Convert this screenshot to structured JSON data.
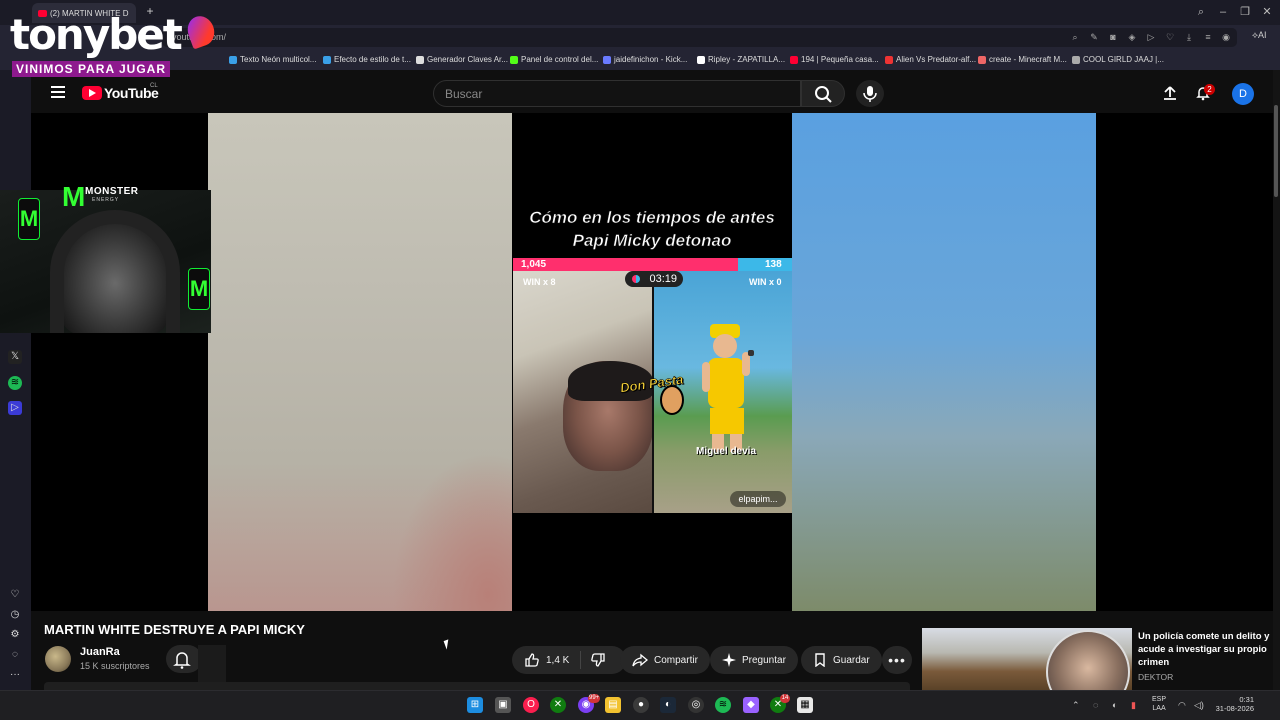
{
  "browser": {
    "tab_title": "(2) MARTIN WHITE D",
    "url": "youtube.com/",
    "ai_label": "AI",
    "bookmarks": [
      {
        "label": "Texto Neón multicol...",
        "color": "#3aa0e8"
      },
      {
        "label": "Efecto de estilo de t...",
        "color": "#3aa0e8"
      },
      {
        "label": "Generador Claves Ar...",
        "color": "#dddddd"
      },
      {
        "label": "Panel de control del...",
        "color": "#53fc18"
      },
      {
        "label": "jaidefinichon - Kick...",
        "color": "#6a7bff"
      },
      {
        "label": "Ripley - ZAPATILLA...",
        "color": "#ffffff"
      },
      {
        "label": "194 | Pequeña casa...",
        "color": "#ff0033"
      },
      {
        "label": "Alien Vs Predator-alf...",
        "color": "#e33"
      },
      {
        "label": "create - Minecraft M...",
        "color": "#e66"
      },
      {
        "label": "COOL GIRLD JAAJ |...",
        "color": "#aaaaaa"
      }
    ]
  },
  "overlay": {
    "brand": "tonybet",
    "brand_tagline": "VINIMOS PARA JUGAR",
    "sponsor": "MONSTER",
    "sponsor_sub": "ENERGY"
  },
  "youtube": {
    "logo_text": "YouTube",
    "country_code": "CL",
    "search_placeholder": "Buscar",
    "notifications": "2",
    "avatar_letter": "D"
  },
  "video": {
    "caption_line1": "Cómo en los tiempos de antes",
    "caption_line2": "Papi Micky detonao",
    "score_left": "1,045",
    "score_right": "138",
    "timer": "03:19",
    "win_left": "WIN x 8",
    "win_right": "WIN x 0",
    "sticker_text": "Don Pasta",
    "right_user": "Miguel devia",
    "tiktok_user": "elpapim..."
  },
  "details": {
    "title": "MARTIN WHITE DESTRUYE A PAPI MICKY",
    "channel": "JuanRa",
    "subscribers": "15 K suscriptores",
    "likes": "1,4 K",
    "share": "Compartir",
    "ask": "Preguntar",
    "save": "Guardar"
  },
  "recommendation": {
    "title": "Un policía comete un delito y acude a investigar su propio crimen",
    "channel": "DEKTOR"
  },
  "taskbar": {
    "lang_top": "ESP",
    "lang_bottom": "LAA",
    "time": "0:31",
    "date": "31-08-2026",
    "badges": {
      "messenger": "99+",
      "xbox": "14"
    }
  },
  "colors": {
    "youtube_red": "#ff0033",
    "brand_purple": "#8e1a8e",
    "avatar_blue": "#1a73e8",
    "pk_pink": "#ff2f6d",
    "pk_blue": "#3cb8e8"
  }
}
